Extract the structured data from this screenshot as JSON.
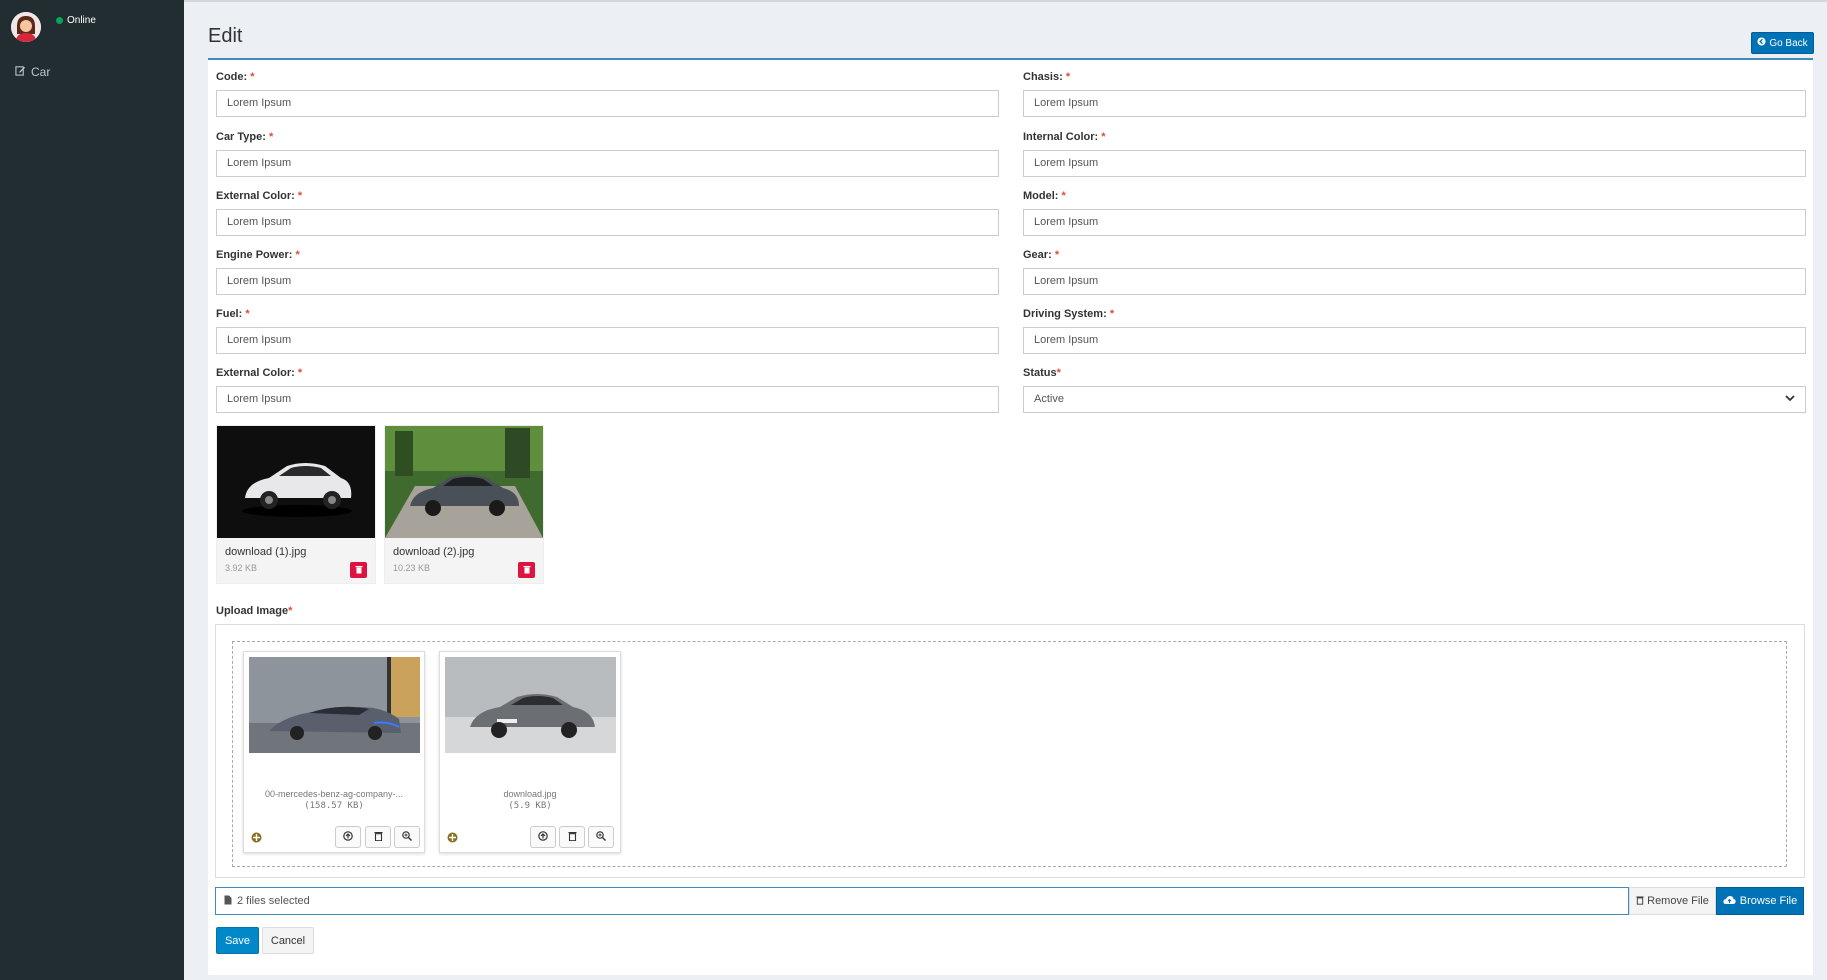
{
  "sidebar": {
    "status": "Online",
    "nav_item": "Car"
  },
  "page": {
    "title": "Edit",
    "go_back_label": "Go Back"
  },
  "form": {
    "code": {
      "label": "Code:",
      "value": "Lorem Ipsum"
    },
    "chasis": {
      "label": "Chasis:",
      "value": "Lorem Ipsum"
    },
    "car_type": {
      "label": "Car Type:",
      "value": "Lorem Ipsum"
    },
    "internal_color": {
      "label": "Internal Color:",
      "value": "Lorem Ipsum"
    },
    "external_color": {
      "label": "External Color:",
      "value": "Lorem Ipsum"
    },
    "model": {
      "label": "Model:",
      "value": "Lorem Ipsum"
    },
    "engine_power": {
      "label": "Engine Power:",
      "value": "Lorem Ipsum"
    },
    "gear": {
      "label": "Gear:",
      "value": "Lorem Ipsum"
    },
    "fuel": {
      "label": "Fuel:",
      "value": "Lorem Ipsum"
    },
    "driving_system": {
      "label": "Driving System:",
      "value": "Lorem Ipsum"
    },
    "external_color_2": {
      "label": "External Color:",
      "value": "Lorem Ipsum"
    },
    "status": {
      "label": "Status",
      "value": "Active"
    },
    "required_mark": "*"
  },
  "existing_images": [
    {
      "name": "download (1).jpg",
      "size": "3.92 KB"
    },
    {
      "name": "download (2).jpg",
      "size": "10.23 KB"
    }
  ],
  "upload": {
    "label": "Upload Image",
    "previews": [
      {
        "name": "00-mercedes-benz-ag-company-...",
        "size": "(158.57 KB)"
      },
      {
        "name": "download.jpg",
        "size": "(5.9 KB)"
      }
    ],
    "caption": "2 files selected",
    "remove_label": "Remove File",
    "browse_label": "Browse File"
  },
  "actions": {
    "save_label": "Save",
    "cancel_label": "Cancel"
  },
  "colors": {
    "sidebar": "#222d32",
    "primary": "#0073b7",
    "danger": "#dd1440",
    "online": "#00a65a"
  }
}
